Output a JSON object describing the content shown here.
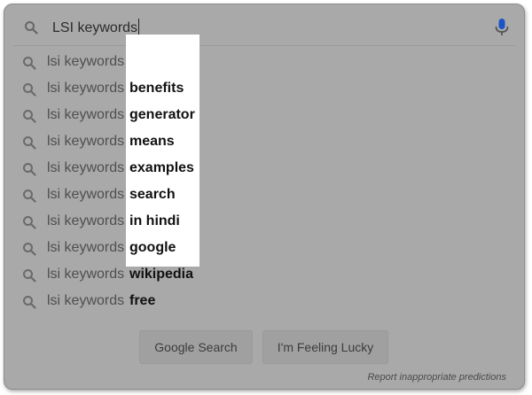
{
  "search": {
    "query": "LSI keywords"
  },
  "suggestions": [
    {
      "prefix": "lsi keywords",
      "suffix": ""
    },
    {
      "prefix": "lsi keywords",
      "suffix": "benefits"
    },
    {
      "prefix": "lsi keywords",
      "suffix": "generator"
    },
    {
      "prefix": "lsi keywords",
      "suffix": "means"
    },
    {
      "prefix": "lsi keywords",
      "suffix": "examples"
    },
    {
      "prefix": "lsi keywords",
      "suffix": "search"
    },
    {
      "prefix": "lsi keywords",
      "suffix": "in hindi"
    },
    {
      "prefix": "lsi keywords",
      "suffix": "google"
    },
    {
      "prefix": "lsi keywords",
      "suffix": "wikipedia"
    },
    {
      "prefix": "lsi keywords",
      "suffix": "free"
    }
  ],
  "buttons": {
    "google_search": "Google Search",
    "feeling_lucky": "I'm Feeling Lucky"
  },
  "footer": {
    "report_link": "Report inappropriate predictions"
  },
  "icons": {
    "search": "search-icon",
    "mic": "mic-icon"
  },
  "colors": {
    "mic_accent": "#1a55c8",
    "overlay": "#a9a9a9",
    "highlight": "#ffffff"
  }
}
